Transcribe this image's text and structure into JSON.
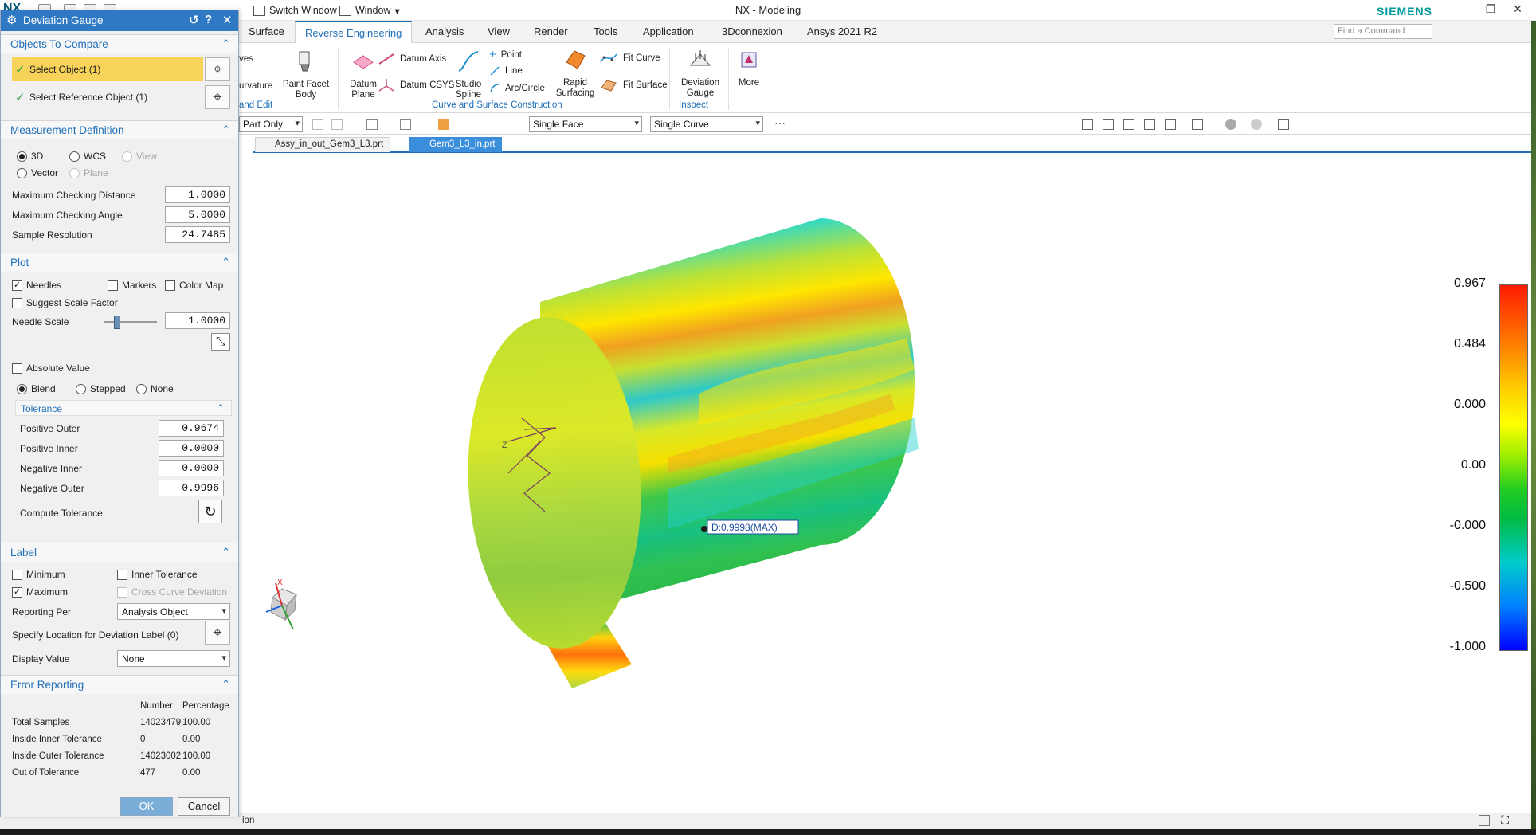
{
  "window": {
    "app_title": "NX - Modeling",
    "brand": "SIEMENS",
    "logo": "NX",
    "switch_window": "Switch Window",
    "window_menu": "Window"
  },
  "ribbon": {
    "tabs": [
      "Surface",
      "Reverse Engineering",
      "Analysis",
      "View",
      "Render",
      "Tools",
      "Application",
      "3Dconnexion",
      "Ansys 2021 R2"
    ],
    "active_tab": "Reverse Engineering",
    "find_placeholder": "Find a Command",
    "cmd_paint_facet_body": "Paint Facet Body",
    "cmd_curvature_partial": "urvature",
    "cmd_curves_partial": "ves",
    "cmd_datum_plane": "Datum Plane",
    "cmd_datum_axis": "Datum Axis",
    "cmd_datum_csys": "Datum CSYS",
    "cmd_studio_spline": "Studio Spline",
    "cmd_point": "Point",
    "cmd_line": "Line",
    "cmd_arc_circle": "Arc/Circle",
    "cmd_rapid_surfacing": "Rapid Surfacing",
    "cmd_fit_curve": "Fit Curve",
    "cmd_fit_surface": "Fit Surface",
    "cmd_deviation_gauge": "Deviation Gauge",
    "cmd_more": "More",
    "group_and_edit": "and Edit",
    "group_curve_surface": "Curve and Surface Construction",
    "group_inspect": "Inspect"
  },
  "toolbar2": {
    "filter_scope": "Part Only",
    "face_rule": "Single Face",
    "curve_rule": "Single Curve"
  },
  "doc_tabs": [
    {
      "label": "Assy_in_out_Gem3_L3.prt",
      "active": false
    },
    {
      "label": "Gem3_L3_in.prt",
      "active": true
    }
  ],
  "dialog": {
    "title": "Deviation Gauge",
    "ctrl_reset": "↺",
    "ctrl_help": "?",
    "ctrl_close": "✕",
    "objects_to_compare": {
      "header": "Objects To Compare",
      "select_object": "Select Object (1)",
      "select_reference": "Select Reference Object (1)"
    },
    "measurement": {
      "header": "Measurement Definition",
      "opt_3d": "3D",
      "opt_wcs": "WCS",
      "opt_view": "View",
      "opt_vector": "Vector",
      "opt_plane": "Plane",
      "max_dist_label": "Maximum Checking Distance",
      "max_dist": "1.0000",
      "max_angle_label": "Maximum Checking Angle",
      "max_angle": "5.0000",
      "sample_res_label": "Sample Resolution",
      "sample_res": "24.7485"
    },
    "plot": {
      "header": "Plot",
      "needles": "Needles",
      "markers": "Markers",
      "color_map": "Color Map",
      "suggest_scale": "Suggest Scale Factor",
      "needle_scale_label": "Needle Scale",
      "needle_scale": "1.0000",
      "needle_scale_fraction": 0.2,
      "absolute_value": "Absolute Value",
      "blend": "Blend",
      "stepped": "Stepped",
      "none": "None",
      "tolerance_header": "Tolerance",
      "pos_outer_label": "Positive Outer",
      "pos_outer": "0.9674",
      "pos_inner_label": "Positive Inner",
      "pos_inner": "0.0000",
      "neg_inner_label": "Negative Inner",
      "neg_inner": "-0.0000",
      "neg_outer_label": "Negative Outer",
      "neg_outer": "-0.9996",
      "compute_tol_label": "Compute Tolerance"
    },
    "label": {
      "header": "Label",
      "minimum": "Minimum",
      "inner_tolerance": "Inner Tolerance",
      "maximum": "Maximum",
      "cross_curve": "Cross Curve Deviation",
      "reporting_per_label": "Reporting Per",
      "reporting_per": "Analysis Object",
      "specify_location": "Specify Location for Deviation Label (0)",
      "display_value_label": "Display Value",
      "display_value": "None"
    },
    "error_reporting": {
      "header": "Error Reporting",
      "col_number": "Number",
      "col_percentage": "Percentage",
      "rows": [
        {
          "label": "Total Samples",
          "number": "14023479",
          "pct": "100.00"
        },
        {
          "label": "Inside Inner Tolerance",
          "number": "0",
          "pct": "0.00"
        },
        {
          "label": "Inside Outer Tolerance",
          "number": "14023002",
          "pct": "100.00"
        },
        {
          "label": "Out of Tolerance",
          "number": "477",
          "pct": "0.00"
        }
      ]
    },
    "ok": "OK",
    "cancel": "Cancel"
  },
  "viewport": {
    "max_label": "D:0.9998(MAX)",
    "csys_z": "Z",
    "triad_x": "X"
  },
  "legend": {
    "labels": [
      "0.967",
      "0.484",
      "0.000",
      "0.00",
      "-0.000",
      "-0.500",
      "-1.000"
    ],
    "colors": [
      "#ff1a00",
      "#ffff00",
      "#22cc22",
      "#00cccc",
      "#0000ff"
    ]
  },
  "statusbar": {
    "text": "ion"
  }
}
